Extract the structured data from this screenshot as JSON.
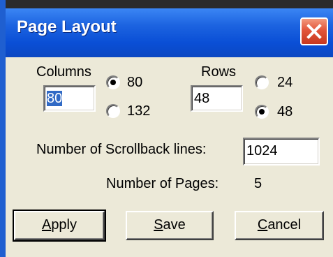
{
  "window": {
    "title": "Page Layout",
    "close_icon": "close-icon"
  },
  "columns": {
    "label": "Columns",
    "value": "80",
    "options": [
      "80",
      "132"
    ],
    "selected": "80"
  },
  "rows": {
    "label": "Rows",
    "value": "48",
    "options": [
      "24",
      "48"
    ],
    "selected": "48"
  },
  "scrollback": {
    "label": "Number of Scrollback lines:",
    "value": "1024"
  },
  "pages": {
    "label": "Number of Pages:",
    "value": "5"
  },
  "buttons": {
    "apply": {
      "accel": "A",
      "rest": "pply"
    },
    "save": {
      "accel": "S",
      "rest": "ave"
    },
    "cancel": {
      "accel": "C",
      "rest": "ancel"
    }
  },
  "colors": {
    "titlebar": "#0a4fd6",
    "close": "#e2553a",
    "face": "#ECE9D8",
    "selection": "#316ac5"
  }
}
